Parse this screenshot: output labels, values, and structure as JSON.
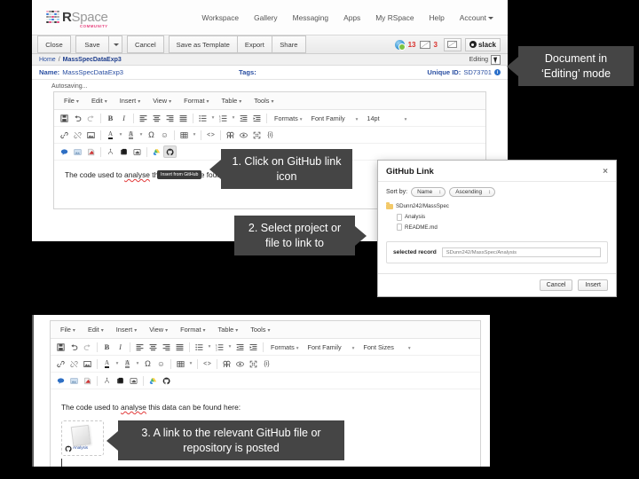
{
  "app": {
    "brand_primary": "R",
    "brand_secondary": "Space",
    "brand_sub": "COMMUNITY",
    "accent_pink": "#e8447f",
    "link_blue": "#2a4fa2",
    "alert_red": "#d9302c"
  },
  "topnav": {
    "items": [
      {
        "label": "Workspace"
      },
      {
        "label": "Gallery"
      },
      {
        "label": "Messaging"
      },
      {
        "label": "Apps"
      },
      {
        "label": "My RSpace"
      },
      {
        "label": "Help"
      },
      {
        "label": "Account"
      }
    ]
  },
  "actionbar": {
    "buttons": [
      {
        "label": "Close"
      },
      {
        "label": "Save"
      },
      {
        "label": "Cancel"
      },
      {
        "label": "Save as Template"
      },
      {
        "label": "Export"
      },
      {
        "label": "Share"
      }
    ],
    "notifications_count": "13",
    "messages_count": "3",
    "slack_label": "slack"
  },
  "breadcrumb": {
    "home": "Home",
    "separator": "/",
    "current": "MassSpecDataExp3",
    "mode_label": "Editing"
  },
  "meta": {
    "name_label": "Name:",
    "name_value": "MassSpecDataExp3",
    "tags_label": "Tags:",
    "tags_value": "",
    "uid_label": "Unique ID:",
    "uid_value": "SD73701",
    "autosave": "Autosaving..."
  },
  "editor_top": {
    "menus": [
      "File",
      "Edit",
      "Insert",
      "View",
      "Format",
      "Table",
      "Tools"
    ],
    "formats_label": "Formats",
    "font_family_label": "Font Family",
    "font_size_label": "14pt",
    "body_text_pre": "The code used to ",
    "body_text_misspelled": "analyse",
    "body_text_post": " this data can be found here:",
    "github_tooltip": "Insert from GitHub"
  },
  "editor_bottom": {
    "menus": [
      "File",
      "Edit",
      "Insert",
      "View",
      "Format",
      "Table",
      "Tools"
    ],
    "formats_label": "Formats",
    "font_family_label": "Font Family",
    "font_size_label": "Font Sizes",
    "body_text_pre": "The code used to ",
    "body_text_misspelled": "analyse",
    "body_text_post": " this data can be found here:",
    "link_chip_label": "Analysis"
  },
  "github_dialog": {
    "title": "GitHub Link",
    "close_label": "×",
    "sort_label": "Sort by:",
    "sort_field": "Name",
    "sort_order": "Ascending",
    "tree": [
      {
        "label": "SDunn242/MassSpec",
        "type": "folder",
        "depth": 0
      },
      {
        "label": "Analysis",
        "type": "file",
        "depth": 1
      },
      {
        "label": "README.md",
        "type": "file",
        "depth": 1
      }
    ],
    "selected_record_label": "selected record",
    "selected_record_value": "SDunn242/MassSpec/Analysis",
    "cancel_label": "Cancel",
    "insert_label": "Insert"
  },
  "callouts": {
    "editing_mode": "Document in ‘Editing’ mode",
    "step1": "1. Click on GitHub link icon",
    "step2": "2. Select project or file to link to",
    "step3": "3. A link to the relevant GitHub file or repository is posted"
  }
}
